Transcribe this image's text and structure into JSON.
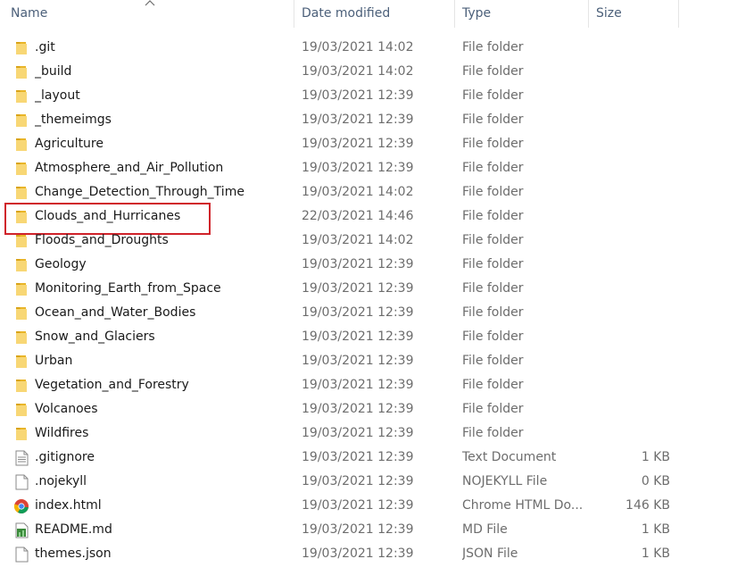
{
  "columns": {
    "name": "Name",
    "date_modified": "Date modified",
    "type": "Type",
    "size": "Size"
  },
  "colors": {
    "folder": "#f4c542",
    "folder_dark": "#e0a800",
    "header_text": "#4c607a",
    "highlight_border": "#d0222a"
  },
  "files": [
    {
      "icon": "folder-icon",
      "name": ".git",
      "date": "19/03/2021 14:02",
      "type": "File folder",
      "size": ""
    },
    {
      "icon": "folder-icon",
      "name": "_build",
      "date": "19/03/2021 14:02",
      "type": "File folder",
      "size": ""
    },
    {
      "icon": "folder-icon",
      "name": "_layout",
      "date": "19/03/2021 12:39",
      "type": "File folder",
      "size": ""
    },
    {
      "icon": "folder-icon",
      "name": "_themeimgs",
      "date": "19/03/2021 12:39",
      "type": "File folder",
      "size": ""
    },
    {
      "icon": "folder-icon",
      "name": "Agriculture",
      "date": "19/03/2021 12:39",
      "type": "File folder",
      "size": ""
    },
    {
      "icon": "folder-icon",
      "name": "Atmosphere_and_Air_Pollution",
      "date": "19/03/2021 12:39",
      "type": "File folder",
      "size": ""
    },
    {
      "icon": "folder-icon",
      "name": "Change_Detection_Through_Time",
      "date": "19/03/2021 14:02",
      "type": "File folder",
      "size": ""
    },
    {
      "icon": "folder-icon",
      "name": "Clouds_and_Hurricanes",
      "date": "22/03/2021 14:46",
      "type": "File folder",
      "size": "",
      "highlighted": true
    },
    {
      "icon": "folder-icon",
      "name": "Floods_and_Droughts",
      "date": "19/03/2021 14:02",
      "type": "File folder",
      "size": ""
    },
    {
      "icon": "folder-icon",
      "name": "Geology",
      "date": "19/03/2021 12:39",
      "type": "File folder",
      "size": ""
    },
    {
      "icon": "folder-icon",
      "name": "Monitoring_Earth_from_Space",
      "date": "19/03/2021 12:39",
      "type": "File folder",
      "size": ""
    },
    {
      "icon": "folder-icon",
      "name": "Ocean_and_Water_Bodies",
      "date": "19/03/2021 12:39",
      "type": "File folder",
      "size": ""
    },
    {
      "icon": "folder-icon",
      "name": "Snow_and_Glaciers",
      "date": "19/03/2021 12:39",
      "type": "File folder",
      "size": ""
    },
    {
      "icon": "folder-icon",
      "name": "Urban",
      "date": "19/03/2021 12:39",
      "type": "File folder",
      "size": ""
    },
    {
      "icon": "folder-icon",
      "name": "Vegetation_and_Forestry",
      "date": "19/03/2021 12:39",
      "type": "File folder",
      "size": ""
    },
    {
      "icon": "folder-icon",
      "name": "Volcanoes",
      "date": "19/03/2021 12:39",
      "type": "File folder",
      "size": ""
    },
    {
      "icon": "folder-icon",
      "name": "Wildfires",
      "date": "19/03/2021 12:39",
      "type": "File folder",
      "size": ""
    },
    {
      "icon": "text-document-icon",
      "name": ".gitignore",
      "date": "19/03/2021 12:39",
      "type": "Text Document",
      "size": "1 KB"
    },
    {
      "icon": "blank-file-icon",
      "name": ".nojekyll",
      "date": "19/03/2021 12:39",
      "type": "NOJEKYLL File",
      "size": "0 KB"
    },
    {
      "icon": "chrome-icon",
      "name": "index.html",
      "date": "19/03/2021 12:39",
      "type": "Chrome HTML Do...",
      "size": "146 KB"
    },
    {
      "icon": "markdown-file-icon",
      "name": "README.md",
      "date": "19/03/2021 12:39",
      "type": "MD File",
      "size": "1 KB"
    },
    {
      "icon": "blank-file-icon",
      "name": "themes.json",
      "date": "19/03/2021 12:39",
      "type": "JSON File",
      "size": "1 KB"
    }
  ]
}
